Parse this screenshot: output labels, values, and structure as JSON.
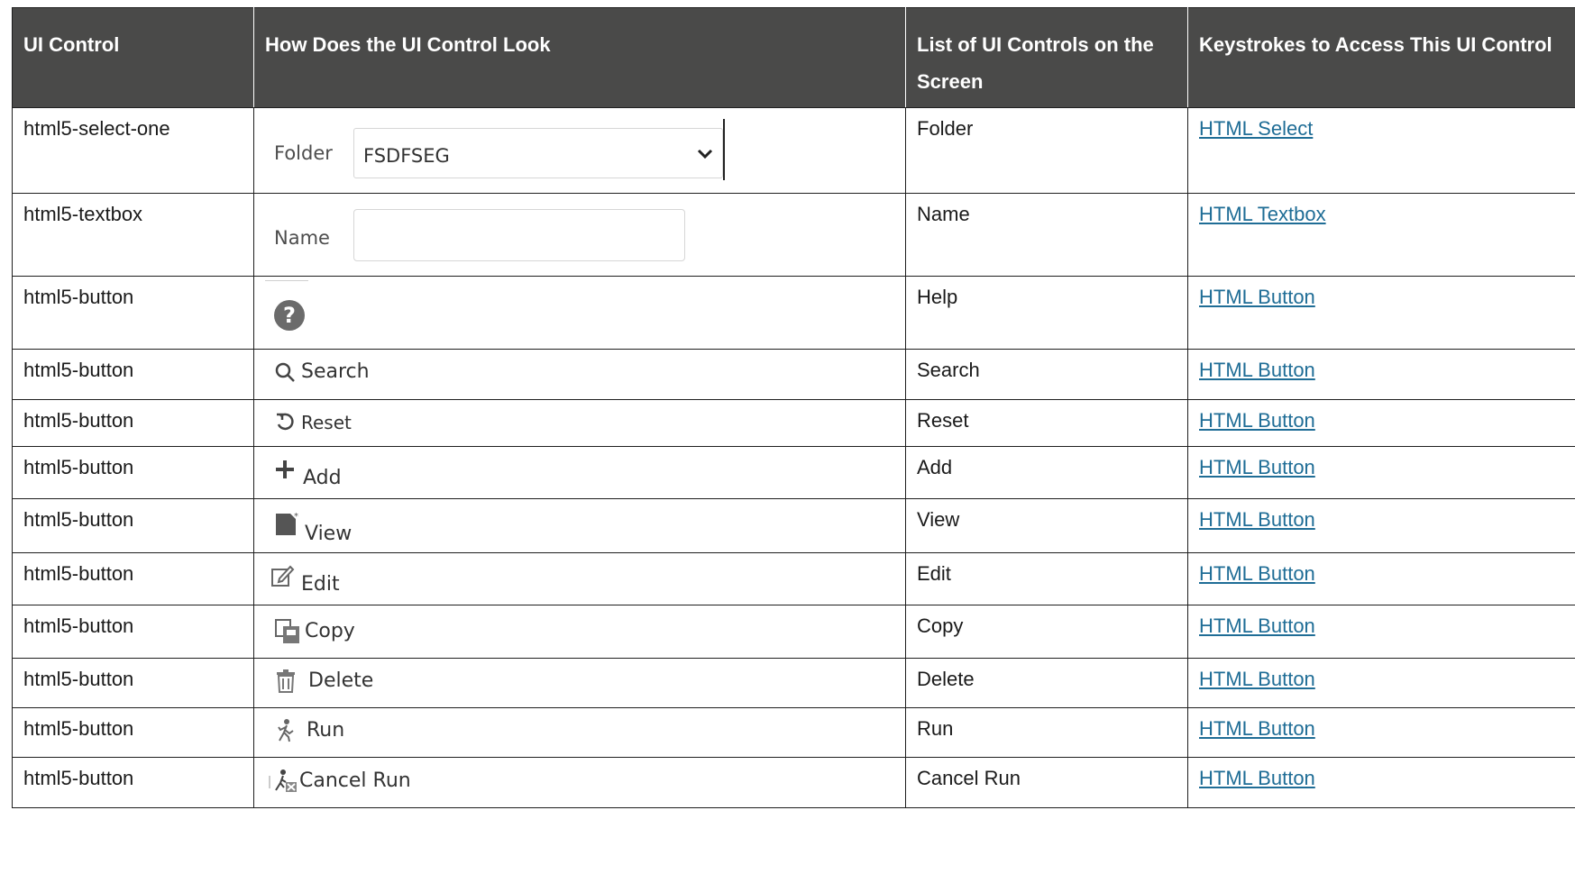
{
  "headers": {
    "c1": "UI Control",
    "c2": "How Does the UI Control Look",
    "c3": "List of UI Controls on the Screen",
    "c4": "Keystrokes to Access This UI Control"
  },
  "rows": [
    {
      "control": "html5-select-one",
      "sample_label": "Folder",
      "sample_value": "FSDFSEG",
      "list": "Folder",
      "link": "HTML Select"
    },
    {
      "control": "html5-textbox",
      "sample_label": "Name",
      "list": "Name",
      "link": "HTML Textbox"
    },
    {
      "control": "html5-button",
      "icon": "help-icon",
      "list": "Help",
      "link": "HTML Button"
    },
    {
      "control": "html5-button",
      "icon": "search-icon",
      "sample_label": "Search",
      "list": "Search",
      "link": "HTML Button"
    },
    {
      "control": "html5-button",
      "icon": "reset-icon",
      "sample_label": "Reset",
      "list": "Reset",
      "link": "HTML Button"
    },
    {
      "control": "html5-button",
      "icon": "plus-icon",
      "sample_label": "Add",
      "list": "Add",
      "link": "HTML Button"
    },
    {
      "control": "html5-button",
      "icon": "view-icon",
      "sample_label": "View",
      "list": "View",
      "link": "HTML Button"
    },
    {
      "control": "html5-button",
      "icon": "edit-icon",
      "sample_label": "Edit",
      "list": "Edit",
      "link": "HTML Button"
    },
    {
      "control": "html5-button",
      "icon": "copy-icon",
      "sample_label": "Copy",
      "list": "Copy",
      "link": "HTML Button"
    },
    {
      "control": "html5-button",
      "icon": "trash-icon",
      "sample_label": "Delete",
      "list": "Delete",
      "link": "HTML Button"
    },
    {
      "control": "html5-button",
      "icon": "run-icon",
      "sample_label": "Run",
      "list": "Run",
      "link": "HTML Button"
    },
    {
      "control": "html5-button",
      "icon": "cancel-run-icon",
      "sample_label": "Cancel Run",
      "list": "Cancel Run",
      "link": "HTML Button"
    }
  ],
  "colors": {
    "header_bg": "#4a4a49",
    "link": "#1f6d96",
    "border": "#1e1e1e"
  }
}
